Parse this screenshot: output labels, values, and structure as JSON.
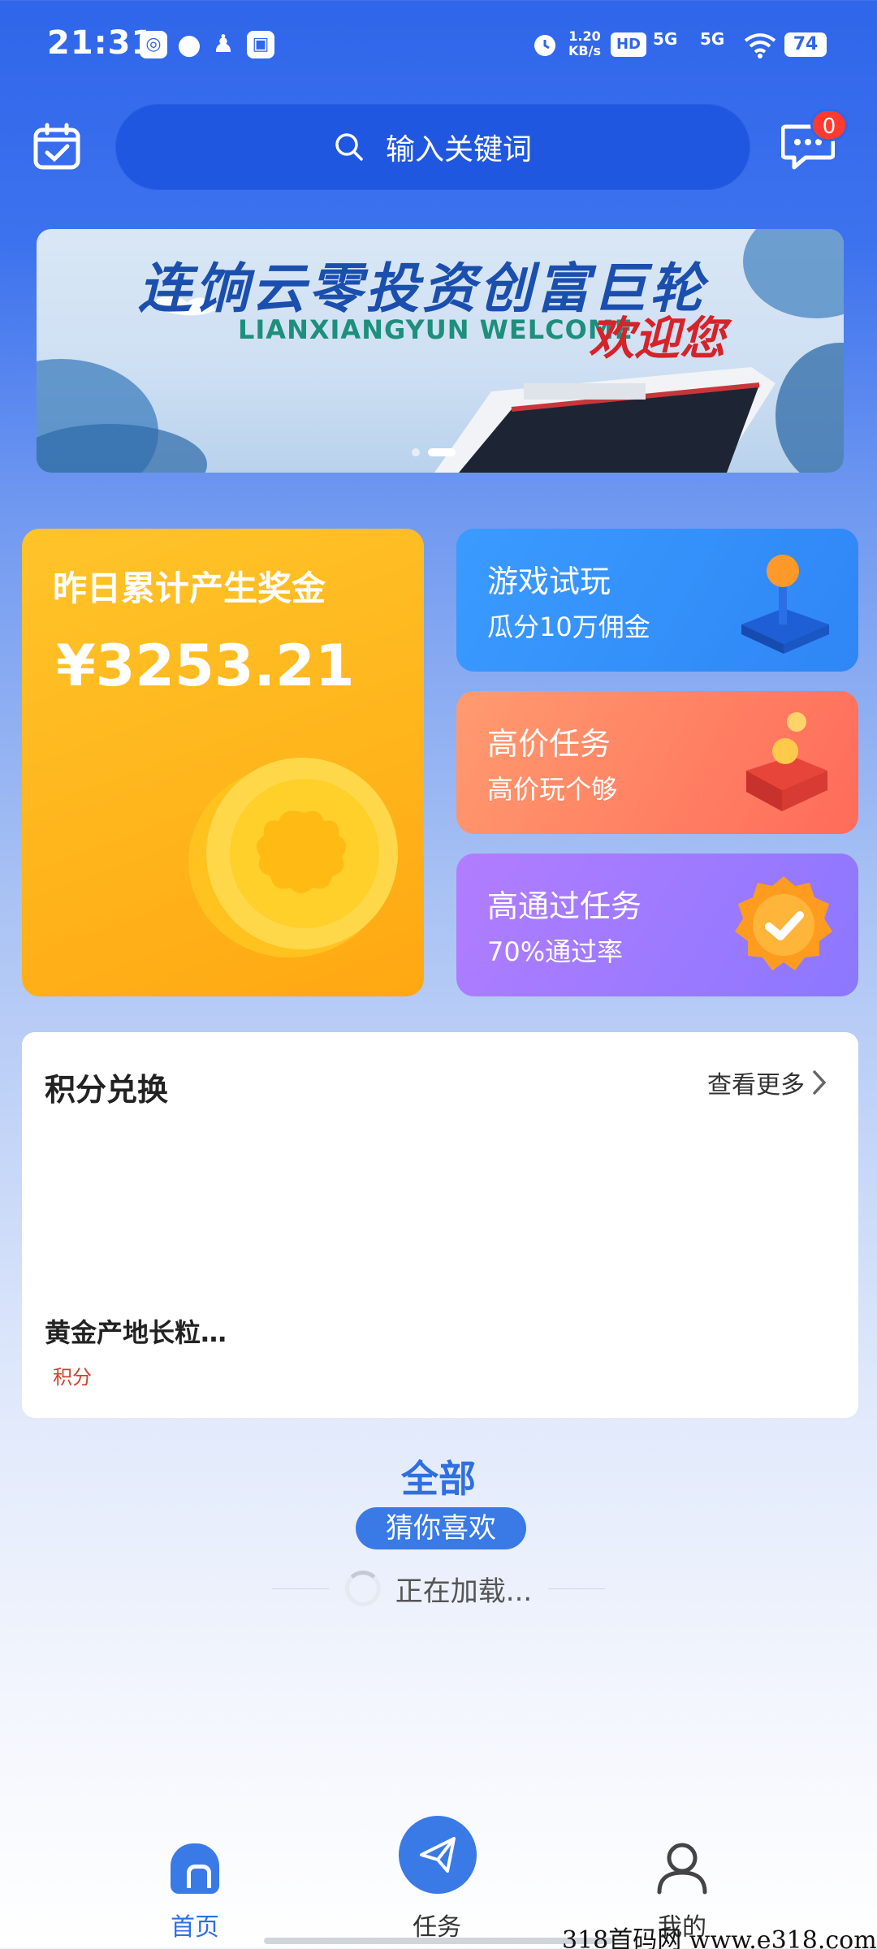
{
  "status_bar": {
    "time": "21:31",
    "net_speed": "1.20 KB/s",
    "signal_1": "5G",
    "signal_2": "5G",
    "battery": "74"
  },
  "header": {
    "search_placeholder": "输入关键词",
    "message_count": "0"
  },
  "banner": {
    "title": "连饷云零投资创富巨轮",
    "subtitle": "LIANXIANGYUN WELCOME",
    "welcome": "欢迎您"
  },
  "bonus_card": {
    "title": "昨日累计产生奖金",
    "amount": "¥3253.21"
  },
  "task_cards": [
    {
      "title": "游戏试玩",
      "subtitle": "瓜分10万佣金"
    },
    {
      "title": "高价任务",
      "subtitle": "高价玩个够"
    },
    {
      "title": "高通过任务",
      "subtitle": "70%通过率"
    }
  ],
  "exchange": {
    "title": "积分兑换",
    "more": "查看更多",
    "product_name": "黄金产地长粒…",
    "product_points": "积分"
  },
  "feed": {
    "all_label": "全部",
    "guess_label": "猜你喜欢",
    "loading_text": "正在加载..."
  },
  "bottom_nav": {
    "home": "首页",
    "task": "任务",
    "mine": "我的"
  },
  "watermark": "318首码网 www.e318.com",
  "colors": {
    "primary": "#2f66ea",
    "accent_blue": "#3a7ae6",
    "gold": "#ffb51c",
    "badge_red": "#ff3b30"
  }
}
